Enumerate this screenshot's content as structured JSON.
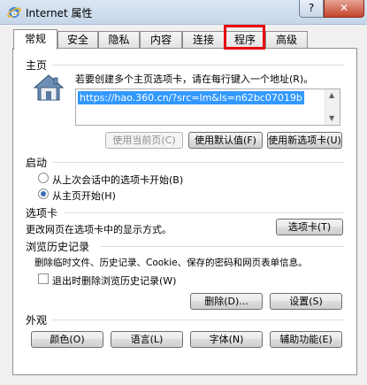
{
  "window": {
    "title": "Internet 属性",
    "help_label": "?",
    "close_label": "✕"
  },
  "tabs": [
    {
      "label": "常规",
      "active": true
    },
    {
      "label": "安全"
    },
    {
      "label": "隐私"
    },
    {
      "label": "内容"
    },
    {
      "label": "连接"
    },
    {
      "label": "程序"
    },
    {
      "label": "高级"
    }
  ],
  "homepage": {
    "section": "主页",
    "hint": "若要创建多个主页选项卡，请在每行键入一个地址(R)。",
    "url": "https://hao.360.cn/?src=lm&ls=n62bc07019b",
    "use_current": "使用当前页(C)",
    "use_default": "使用默认值(F)",
    "use_new_tab": "使用新选项卡(U)"
  },
  "startup": {
    "section": "启动",
    "option_last": "从上次会话中的选项卡开始(B)",
    "option_home": "从主页开始(H)"
  },
  "tabs_section": {
    "section": "选项卡",
    "text": "更改网页在选项卡中的显示方式。",
    "button": "选项卡(T)"
  },
  "history": {
    "section": "浏览历史记录",
    "text": "删除临时文件、历史记录、Cookie、保存的密码和网页表单信息。",
    "checkbox_label": "退出时删除浏览历史记录(W)",
    "delete_button": "删除(D)...",
    "settings_button": "设置(S)"
  },
  "appearance": {
    "section": "外观",
    "colors": "颜色(O)",
    "languages": "语言(L)",
    "fonts": "字体(N)",
    "accessibility": "辅助功能(E)"
  }
}
